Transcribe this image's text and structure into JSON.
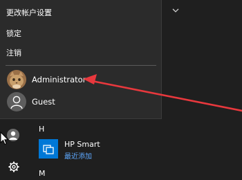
{
  "flyout": {
    "menu": [
      {
        "label": "更改帐户设置"
      },
      {
        "label": "锁定"
      },
      {
        "label": "注销"
      }
    ],
    "users": [
      {
        "name": "Administrator",
        "avatar": "cat-photo-avatar"
      },
      {
        "name": "Guest",
        "avatar": "default-user-avatar"
      }
    ]
  },
  "start_list": {
    "sections": [
      {
        "letter": "H"
      },
      {
        "letter": "M"
      }
    ],
    "apps": [
      {
        "name": "HP Smart",
        "subtitle": "最近添加",
        "icon": "hp-smart-icon"
      }
    ]
  },
  "rail": {
    "icons": [
      "user-icon",
      "gear-icon"
    ]
  },
  "colors": {
    "flyout_bg": "#2b2b2b",
    "background": "#1f1f1f",
    "tile_blue": "#0078d7",
    "recent_text": "#5ea9ff",
    "annotation_arrow": "#e8383d"
  }
}
